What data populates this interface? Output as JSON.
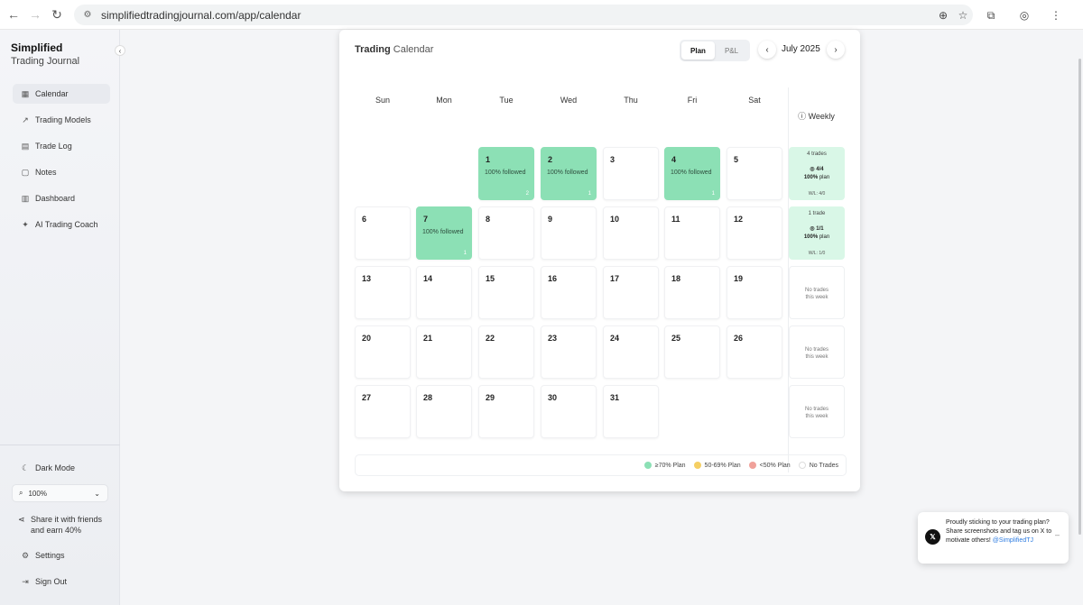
{
  "browser": {
    "url": "simplifiedtradingjournal.com/app/calendar"
  },
  "sidebar": {
    "brand_line1": "Simplified",
    "brand_line2": "Trading Journal",
    "items": [
      {
        "label": "Calendar",
        "icon": "calendar-icon"
      },
      {
        "label": "Trading Models",
        "icon": "trending-up-icon"
      },
      {
        "label": "Trade Log",
        "icon": "document-icon"
      },
      {
        "label": "Notes",
        "icon": "note-icon"
      },
      {
        "label": "Dashboard",
        "icon": "bar-chart-icon"
      },
      {
        "label": "AI Trading Coach",
        "icon": "sparkle-icon"
      }
    ],
    "dark_mode": "Dark Mode",
    "zoom": "100%",
    "share_line1": "Share it with friends",
    "share_line2": "and earn 40%",
    "settings": "Settings",
    "sign_out": "Sign Out"
  },
  "calendar": {
    "title_bold": "Trading",
    "title_rest": "Calendar",
    "toggle": {
      "plan": "Plan",
      "pnl": "P&L"
    },
    "month": "July 2025",
    "weekdays": [
      "Sun",
      "Mon",
      "Tue",
      "Wed",
      "Thu",
      "Fri",
      "Sat"
    ],
    "weekly_label": "Weekly",
    "days": [
      {
        "n": "1",
        "followed": "100% followed",
        "trades": "2"
      },
      {
        "n": "2",
        "followed": "100% followed",
        "trades": "1"
      },
      {
        "n": "3"
      },
      {
        "n": "4",
        "followed": "100% followed",
        "trades": "1"
      },
      {
        "n": "5"
      },
      {
        "n": "6"
      },
      {
        "n": "7",
        "followed": "100% followed",
        "trades": "1"
      },
      {
        "n": "8"
      },
      {
        "n": "9"
      },
      {
        "n": "10"
      },
      {
        "n": "11"
      },
      {
        "n": "12"
      },
      {
        "n": "13"
      },
      {
        "n": "14"
      },
      {
        "n": "15"
      },
      {
        "n": "16"
      },
      {
        "n": "17"
      },
      {
        "n": "18"
      },
      {
        "n": "19"
      },
      {
        "n": "20"
      },
      {
        "n": "21"
      },
      {
        "n": "22"
      },
      {
        "n": "23"
      },
      {
        "n": "24"
      },
      {
        "n": "25"
      },
      {
        "n": "26"
      },
      {
        "n": "27"
      },
      {
        "n": "28"
      },
      {
        "n": "29"
      },
      {
        "n": "30"
      },
      {
        "n": "31"
      }
    ],
    "weeks": [
      {
        "trades": "4 trades",
        "ratio": "4/4",
        "plan_pct": "100%",
        "plan_word": "plan",
        "wl": "W/L: 4/0"
      },
      {
        "trades": "1 trade",
        "ratio": "1/1",
        "plan_pct": "100%",
        "plan_word": "plan",
        "wl": "W/L: 1/0"
      },
      {
        "none1": "No trades",
        "none2": "this week"
      },
      {
        "none1": "No trades",
        "none2": "this week"
      },
      {
        "none1": "No trades",
        "none2": "this week"
      }
    ],
    "legend": [
      {
        "label": "≥70% Plan",
        "color": "#8ce0b5"
      },
      {
        "label": "50-69% Plan",
        "color": "#f5cf63"
      },
      {
        "label": "<50% Plan",
        "color": "#f0a19a"
      },
      {
        "label": "No Trades",
        "color": "#ffffff"
      }
    ]
  },
  "toast": {
    "message": "Proudly sticking to your trading plan? Share screenshots and tag us on X to motivate others!",
    "handle": "@SimplifiedTJ"
  }
}
